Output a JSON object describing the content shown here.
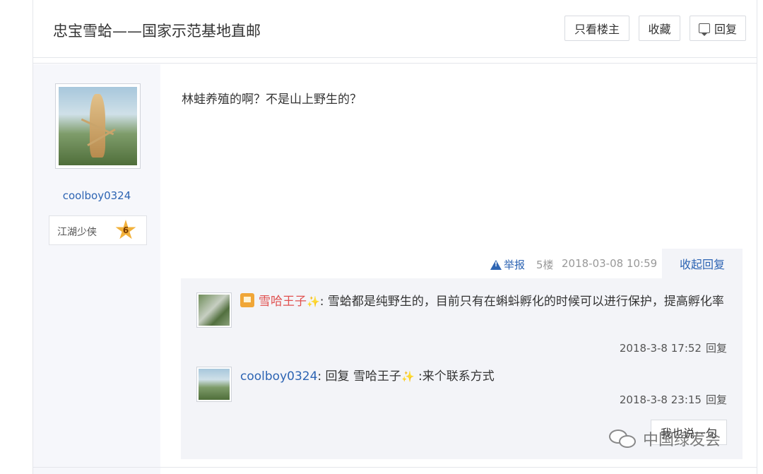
{
  "thread": {
    "title": "忠宝雪蛤——国家示范基地直邮",
    "buttons": {
      "only_op": "只看楼主",
      "favorite": "收藏",
      "reply": "回复"
    }
  },
  "post": {
    "author": {
      "username": "coolboy0324",
      "rank_title": "江湖少侠",
      "rank_level": "6"
    },
    "content": "林蛙养殖的啊？不是山上野生的？",
    "meta": {
      "report_label": "举报",
      "floor": "5楼",
      "datetime": "2018-03-08 10:59",
      "collapse_label": "收起回复"
    }
  },
  "replies": [
    {
      "username": "雪哈王子",
      "sparkle": "✨",
      "separator": ": ",
      "text": "雪蛤都是纯野生的，目前只有在蝌蚪孵化的时候可以进行保护，提高孵化率",
      "datetime": "2018-3-8 17:52",
      "reply_label": "回复"
    },
    {
      "username": "coolboy0324",
      "separator": ": ",
      "reply_prefix": "回复 ",
      "reply_to": "雪哈王子",
      "sparkle": "✨",
      "text": " :来个联系方式",
      "datetime": "2018-3-8 23:15",
      "reply_label": "回复"
    }
  ],
  "say_button": "我也说一句",
  "watermark": "中国绿发会",
  "colors": {
    "link_blue": "#2d64b3",
    "vip_red": "#e0504f",
    "panel_bg": "#f3f4f8",
    "sidebar_bg": "#f6f7fb"
  },
  "icons": {
    "reply": "speech-bubble-icon",
    "report": "warning-triangle-icon",
    "vip": "vip-badge-icon",
    "rank": "star-badge-icon",
    "watermark": "wechat-logo-icon"
  }
}
